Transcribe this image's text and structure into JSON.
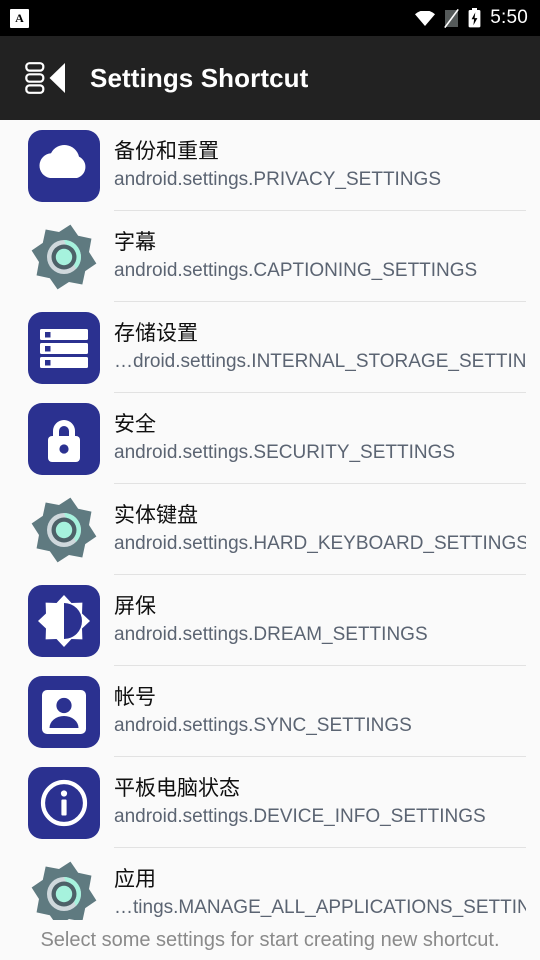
{
  "status_bar": {
    "app_badge_letter": "A",
    "icons": [
      "wifi-icon",
      "sim-card-icon",
      "battery-charging-icon"
    ],
    "time": "5:50"
  },
  "toolbar": {
    "nav_icon": "list-back-icon",
    "title": "Settings Shortcut"
  },
  "colors": {
    "status_bar_bg": "#000000",
    "toolbar_bg": "#222222",
    "page_bg": "#fafafa",
    "icon_blue": "#2b3190",
    "gear_gray": "#5f7a80",
    "gear_mint": "#a6f2dd",
    "title_text": "#101010",
    "subtitle_text": "#5b6472",
    "footer_text": "#8a8a8a",
    "divider": "#e2e2e2"
  },
  "list": {
    "items": [
      {
        "icon": "cloud-upload-icon",
        "icon_style": "blue",
        "title": "备份和重置",
        "subtitle": "android.settings.PRIVACY_SETTINGS"
      },
      {
        "icon": "gear-icon",
        "icon_style": "gear",
        "title": "字幕",
        "subtitle": "android.settings.CAPTIONING_SETTINGS"
      },
      {
        "icon": "storage-list-icon",
        "icon_style": "blue",
        "title": "存储设置",
        "subtitle": "…droid.settings.INTERNAL_STORAGE_SETTINGS"
      },
      {
        "icon": "lock-icon",
        "icon_style": "blue",
        "title": "安全",
        "subtitle": "android.settings.SECURITY_SETTINGS"
      },
      {
        "icon": "gear-icon",
        "icon_style": "gear",
        "title": "实体键盘",
        "subtitle": "android.settings.HARD_KEYBOARD_SETTINGS"
      },
      {
        "icon": "brightness-icon",
        "icon_style": "blue",
        "title": "屏保",
        "subtitle": "android.settings.DREAM_SETTINGS"
      },
      {
        "icon": "account-person-icon",
        "icon_style": "blue",
        "title": "帐号",
        "subtitle": "android.settings.SYNC_SETTINGS"
      },
      {
        "icon": "info-circle-icon",
        "icon_style": "blue",
        "title": "平板电脑状态",
        "subtitle": "android.settings.DEVICE_INFO_SETTINGS"
      },
      {
        "icon": "gear-icon",
        "icon_style": "gear",
        "title": "应用",
        "subtitle": "…tings.MANAGE_ALL_APPLICATIONS_SETTINGS"
      }
    ]
  },
  "footer": {
    "text": "Select some settings for start creating new shortcut."
  }
}
